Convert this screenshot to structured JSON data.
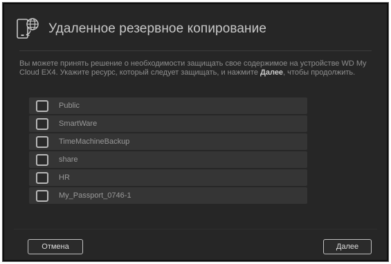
{
  "dialog": {
    "title": "Удаленное резервное копирование",
    "header_icon": "device-globe-icon"
  },
  "description": {
    "text_part1": "Вы можете принять решение о необходимости защищать свое содержимое на устройстве WD My Cloud EX4. Укажите ресурс, который следует защищать, и нажмите ",
    "text_bold": "Далее",
    "text_part2": ", чтобы продолжить."
  },
  "shares": [
    {
      "label": "Public",
      "checked": false
    },
    {
      "label": "SmartWare",
      "checked": false
    },
    {
      "label": "TimeMachineBackup",
      "checked": false
    },
    {
      "label": "share",
      "checked": false
    },
    {
      "label": "HR",
      "checked": false
    },
    {
      "label": "My_Passport_0746-1",
      "checked": false
    }
  ],
  "footer": {
    "cancel_label": "Отмена",
    "next_label": "Далее"
  },
  "colors": {
    "dialog_bg": "#262626",
    "row_bg": "#353535",
    "text_muted": "#8e8e8e"
  }
}
